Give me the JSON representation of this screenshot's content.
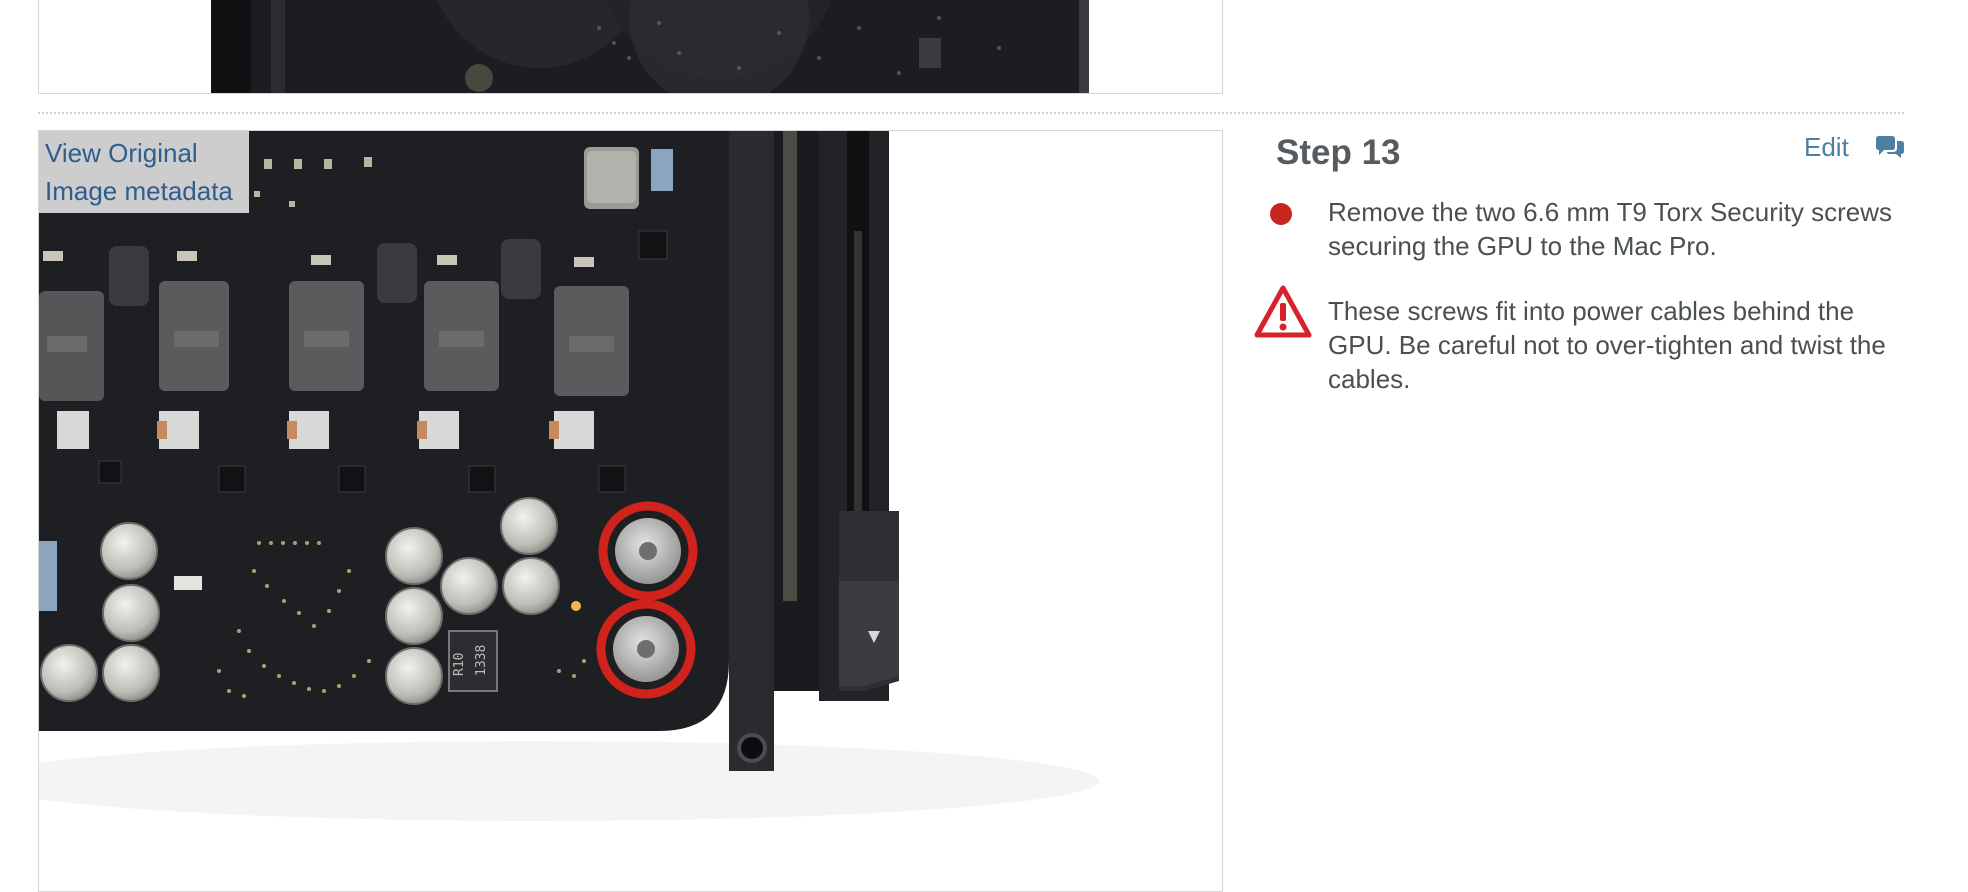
{
  "image_links": {
    "view_original": "View Original",
    "image_metadata": "Image metadata"
  },
  "step": {
    "title": "Step 13",
    "edit_label": "Edit",
    "lines": [
      {
        "bullet": "red",
        "text": "Remove the two 6.6 mm T9 Torx Security screws securing the GPU to the Mac Pro."
      },
      {
        "bullet": "warning-icon",
        "text": "These screws fit into power cables behind the GPU. Be careful not to over-tighten and twist the cables."
      }
    ]
  },
  "photo_markings": [
    "R10",
    "1338"
  ],
  "colors": {
    "bullet_red": "#c8251f",
    "link_blue": "#2e5d8e",
    "edit_blue": "#4d7fa4",
    "warning_red": "#d6232b",
    "title_gray": "#555b5e"
  }
}
